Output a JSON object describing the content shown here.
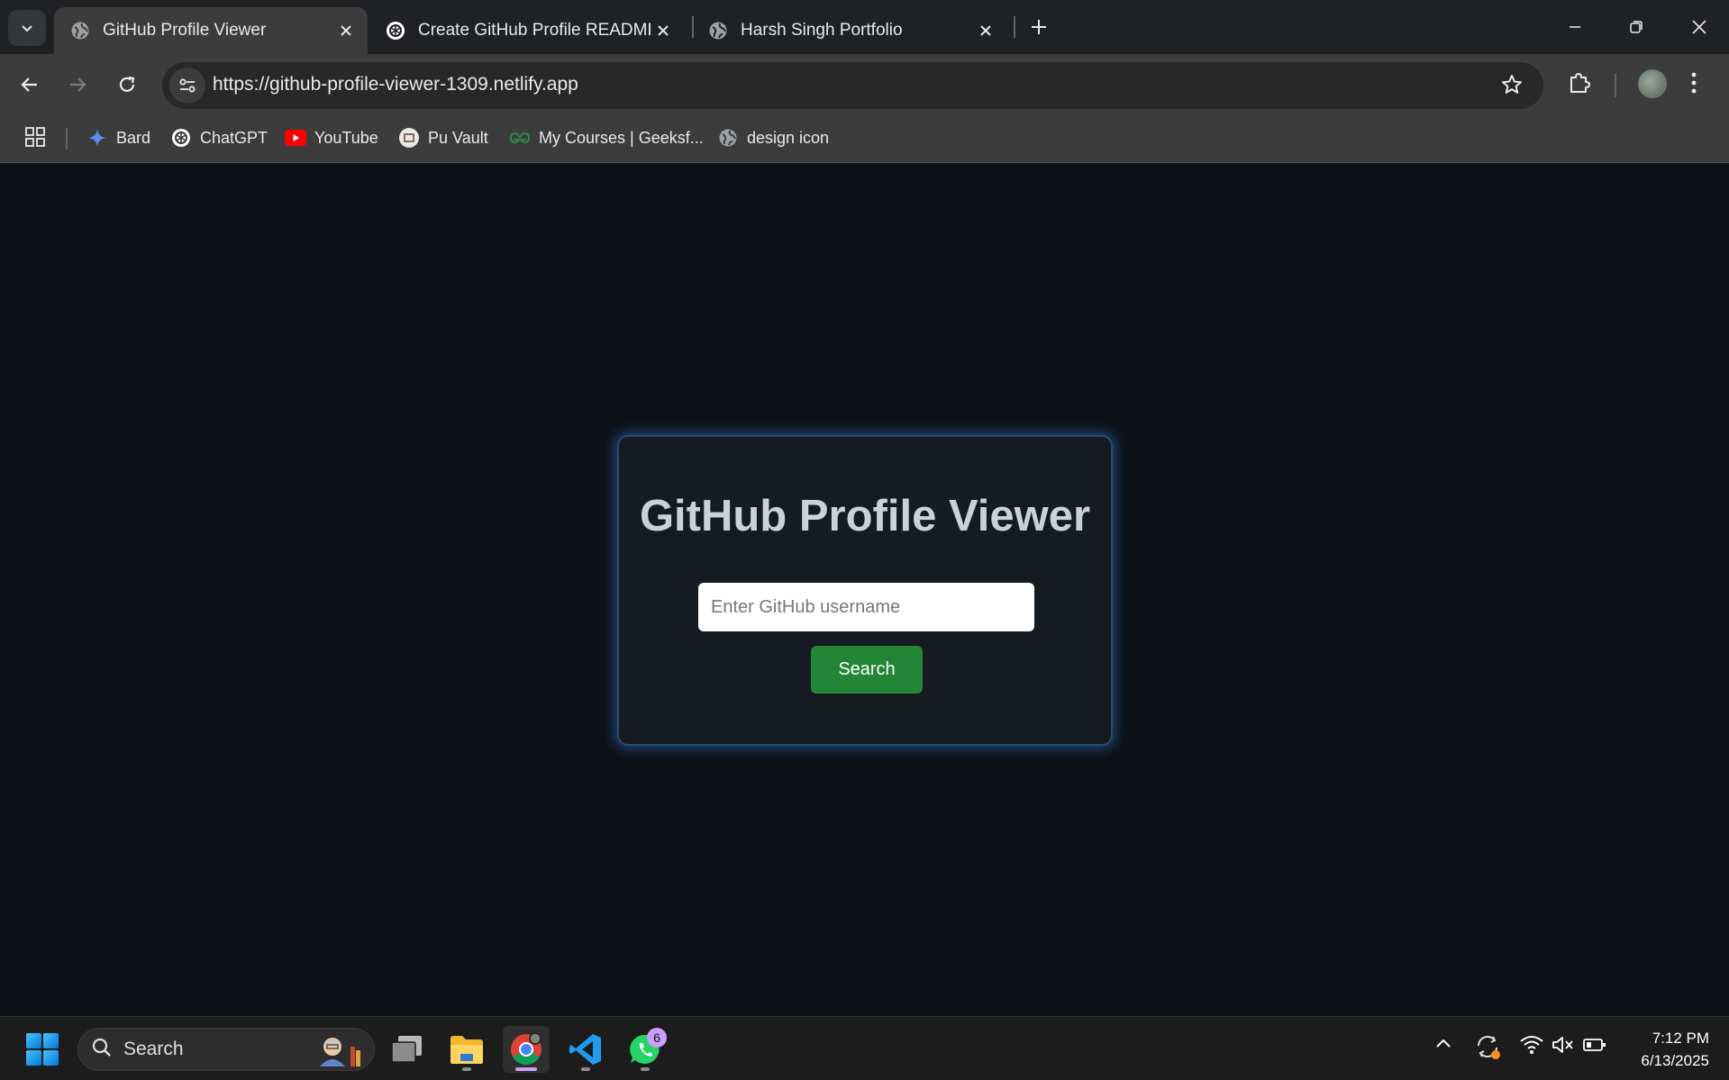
{
  "browser": {
    "tabs": [
      {
        "title": "GitHub Profile Viewer",
        "active": true,
        "favicon": "globe-icon"
      },
      {
        "title": "Create GitHub Profile README",
        "active": false,
        "favicon": "openai-icon"
      },
      {
        "title": "Harsh Singh Portfolio",
        "active": false,
        "favicon": "globe-icon"
      }
    ],
    "url": "https://github-profile-viewer-1309.netlify.app",
    "bookmarks": [
      {
        "label": "Bard",
        "icon": "sparkle-icon"
      },
      {
        "label": "ChatGPT",
        "icon": "openai-icon"
      },
      {
        "label": "YouTube",
        "icon": "youtube-icon"
      },
      {
        "label": "Pu Vault",
        "icon": "vault-icon"
      },
      {
        "label": "My Courses | Geeksf...",
        "icon": "geeksforgeeks-icon"
      },
      {
        "label": "design icon",
        "icon": "globe-icon"
      }
    ]
  },
  "page": {
    "title": "GitHub Profile Viewer",
    "input_placeholder": "Enter GitHub username",
    "input_value": "",
    "search_button": "Search"
  },
  "taskbar": {
    "search_label": "Search",
    "whatsapp_badge": "6",
    "time": "7:12 PM",
    "date": "6/13/2025"
  },
  "colors": {
    "page_bg": "#0d1117",
    "card_bg": "#161b22",
    "card_glow": "#388bfd",
    "title_text": "#c9d1d9",
    "button_bg": "#238636"
  }
}
